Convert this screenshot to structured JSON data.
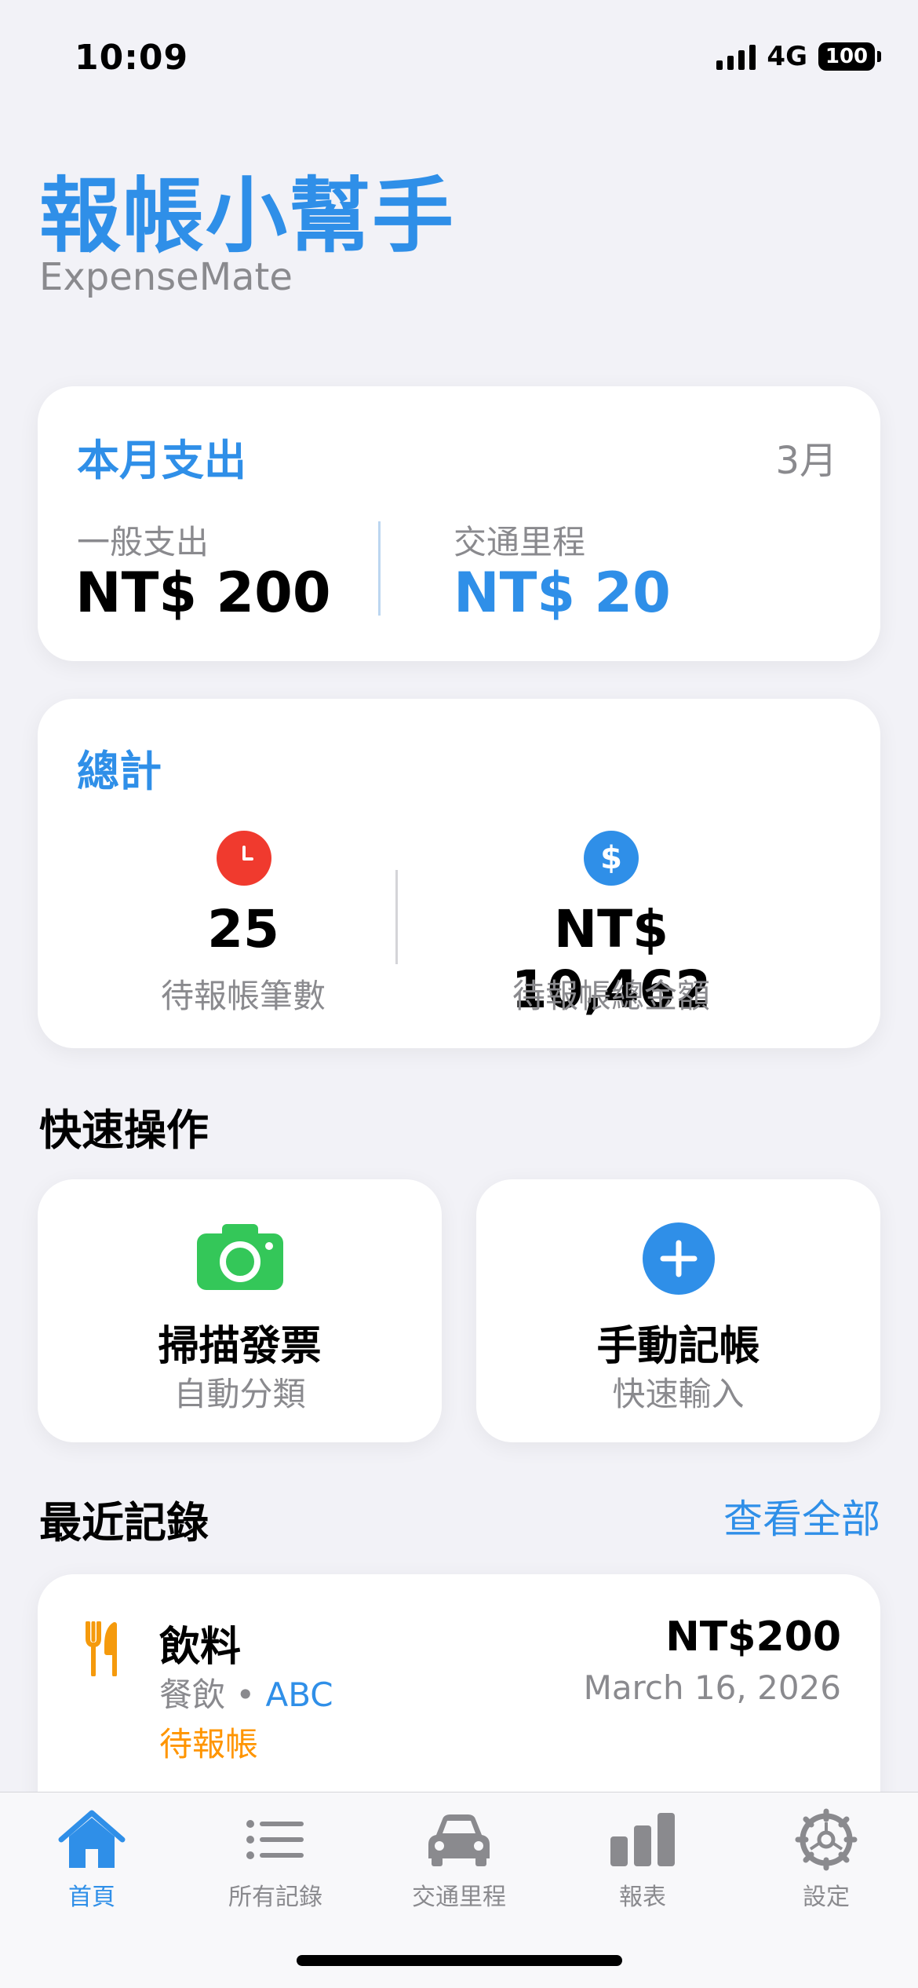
{
  "status_bar": {
    "time": "10:09",
    "network": "4G",
    "battery": "100"
  },
  "header": {
    "title": "報帳小幫手",
    "subtitle": "ExpenseMate"
  },
  "monthly": {
    "title": "本月支出",
    "month": "3月",
    "general_label": "一般支出",
    "general_value": "NT$ 200",
    "mileage_label": "交通里程",
    "mileage_value": "NT$ 20"
  },
  "totals": {
    "title": "總計",
    "count_value": "25",
    "count_label": "待報帳筆數",
    "amount_icon": "$",
    "amount_value": "NT$ 10,462",
    "amount_label": "待報帳總金額"
  },
  "quick_actions": {
    "title": "快速操作",
    "scan": {
      "title": "掃描發票",
      "subtitle": "自動分類",
      "icon": "camera-icon"
    },
    "manual": {
      "title": "手動記帳",
      "subtitle": "快速輸入",
      "icon": "plus-icon"
    }
  },
  "recent": {
    "title": "最近記錄",
    "see_all": "查看全部",
    "items": [
      {
        "title": "飲料",
        "category": "餐飲",
        "separator": " • ",
        "tag": "ABC",
        "status": "待報帳",
        "amount": "NT$200",
        "date": "March 16, 2026",
        "icon": "fork-knife-icon"
      }
    ]
  },
  "tab_bar": {
    "tabs": [
      {
        "label": "首頁",
        "icon": "house-icon",
        "active": true
      },
      {
        "label": "所有記錄",
        "icon": "list-icon",
        "active": false
      },
      {
        "label": "交通里程",
        "icon": "car-icon",
        "active": false
      },
      {
        "label": "報表",
        "icon": "bar-chart-icon",
        "active": false
      },
      {
        "label": "設定",
        "icon": "gear-icon",
        "active": false
      }
    ]
  },
  "colors": {
    "accent": "#2f8fe8",
    "background": "#f2f2f7",
    "clock_red": "#f03a2e",
    "camera_green": "#34c759",
    "pending_orange": "#ff9500",
    "food_orange": "#f59a0c"
  }
}
